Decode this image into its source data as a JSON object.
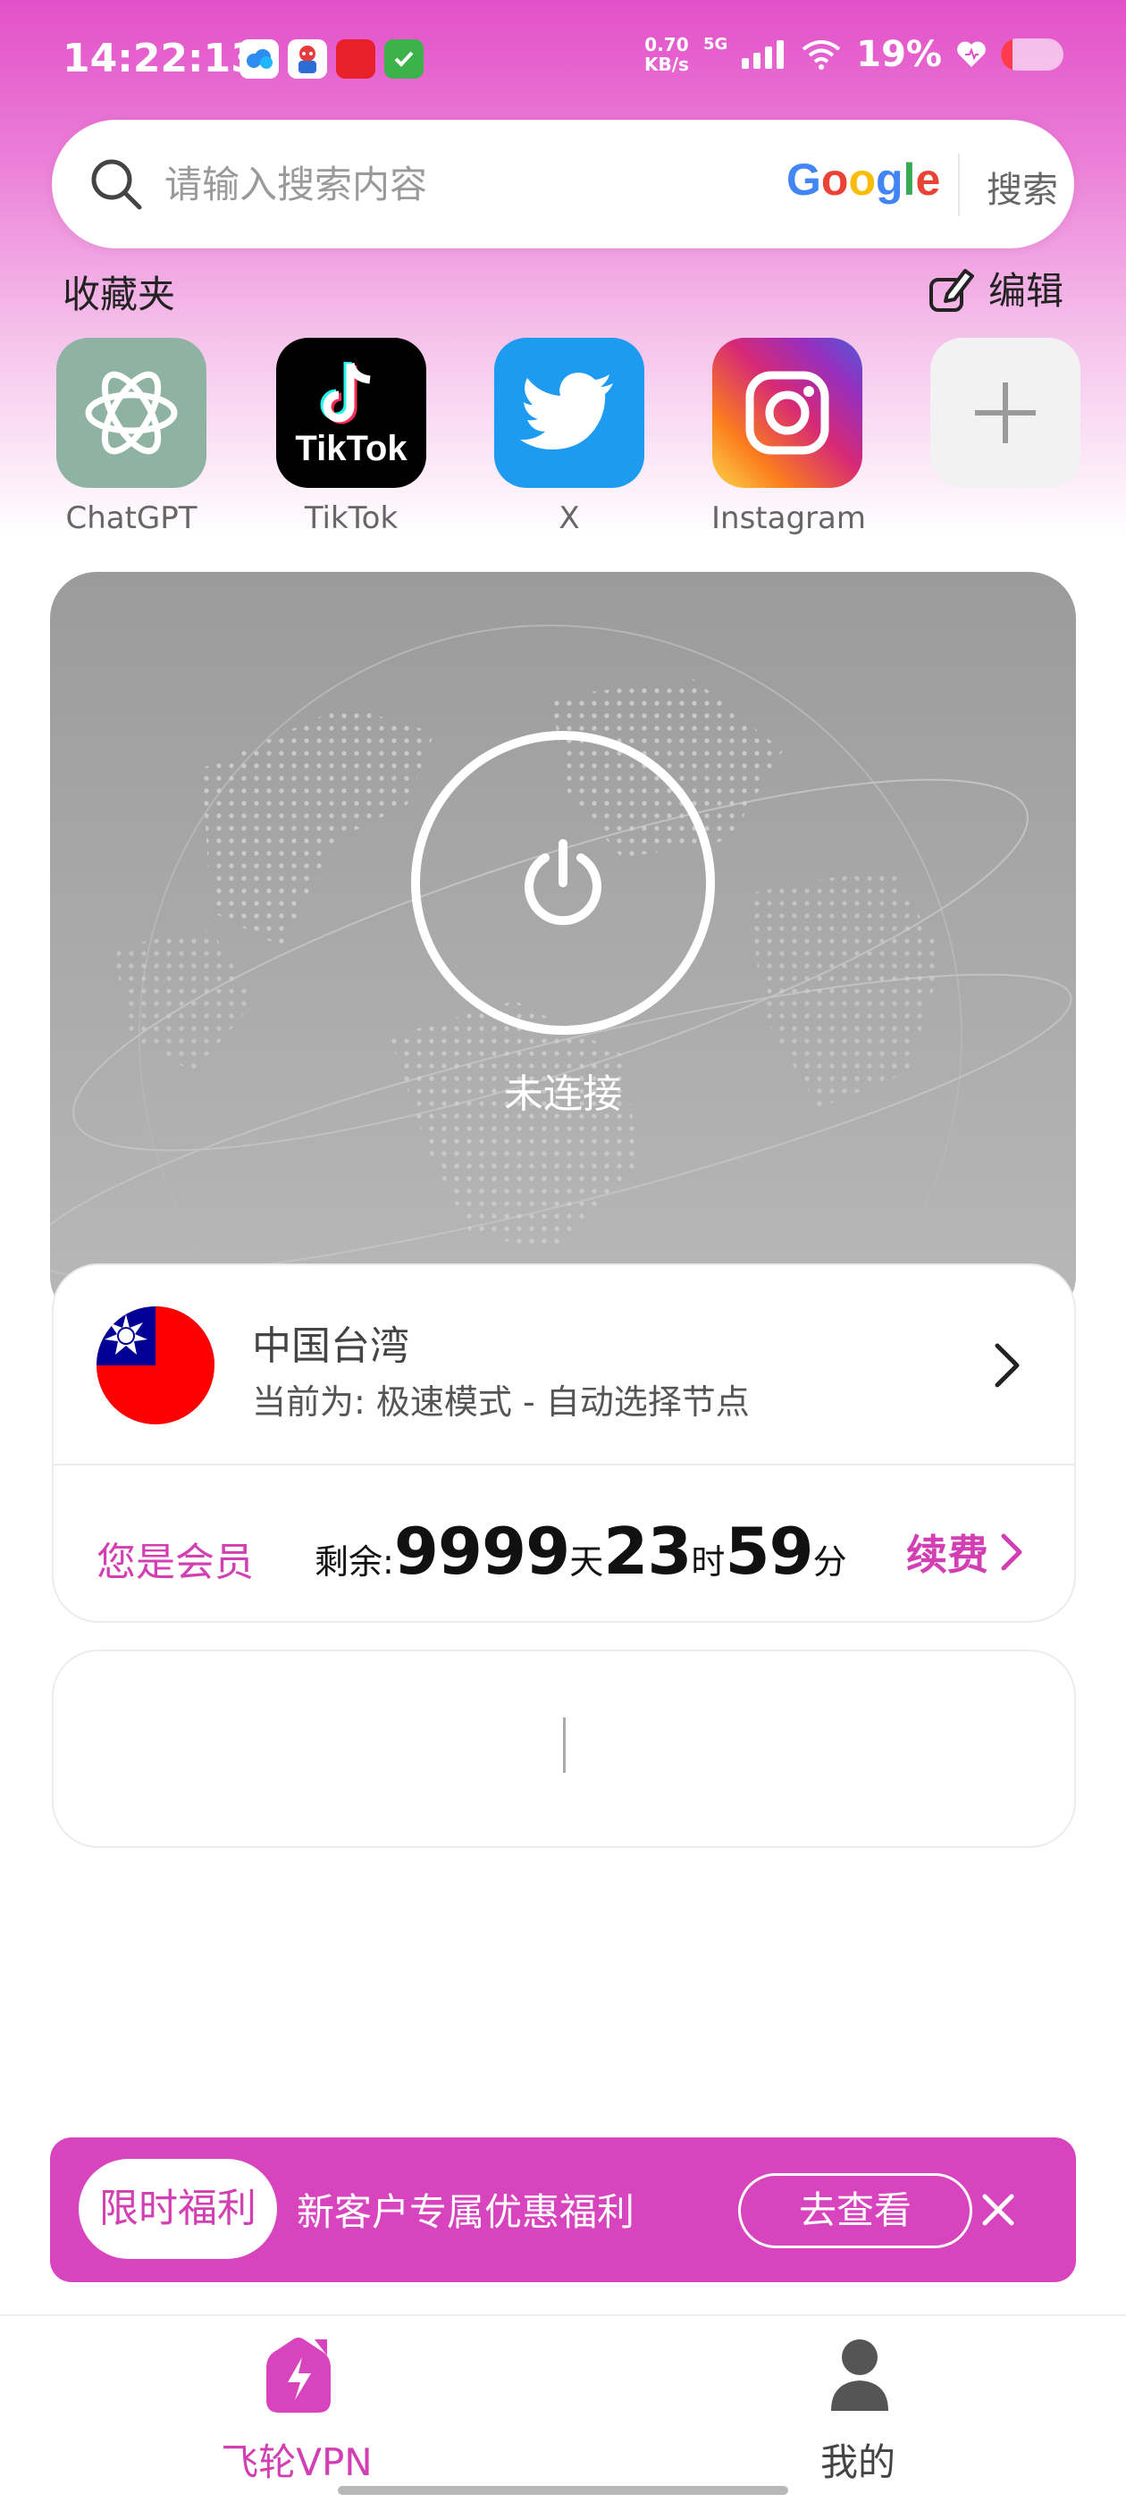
{
  "status_bar": {
    "time": "14:22:13",
    "net_speed_value": "0.70",
    "net_speed_unit": "KB/s",
    "network_type": "5G",
    "battery_percent": "19%",
    "battery_level": 0.19,
    "notification_icons": [
      "cloud-app-icon",
      "mascot-app-icon",
      "red-app-icon",
      "green-check-app-icon"
    ]
  },
  "search": {
    "placeholder": "请输入搜索内容",
    "engine": "Google",
    "button_label": "搜索"
  },
  "favorites": {
    "title": "收藏夹",
    "edit_label": "编辑",
    "items": [
      {
        "label": "ChatGPT",
        "icon": "chatgpt-icon",
        "color": "#8fb3a3"
      },
      {
        "label": "TikTok",
        "icon": "tiktok-icon",
        "color": "#000000"
      },
      {
        "label": "X",
        "icon": "twitter-bird-icon",
        "color": "#1d9bf0"
      },
      {
        "label": "Instagram",
        "icon": "instagram-icon",
        "color": "#e1306c"
      },
      {
        "label": "",
        "icon": "plus-icon",
        "color": "#f2f2f2"
      }
    ]
  },
  "vpn": {
    "status": "未连接",
    "node_name": "中国台湾",
    "node_mode": "当前为: 极速模式 - 自动选择节点",
    "member_label": "您是会员",
    "remaining_prefix": "剩余:",
    "days": "9999",
    "days_unit": "天",
    "hours": "23",
    "hours_unit": "时",
    "minutes": "59",
    "minutes_unit": "分",
    "renew_label": "续费"
  },
  "promo": {
    "badge": "限时福利",
    "text": "新客户专属优惠福利",
    "view_label": "去查看"
  },
  "bottom_nav": {
    "home_label": "飞轮VPN",
    "profile_label": "我的"
  },
  "colors": {
    "accent": "#d744bd",
    "accent_text": "#d23fb2"
  }
}
